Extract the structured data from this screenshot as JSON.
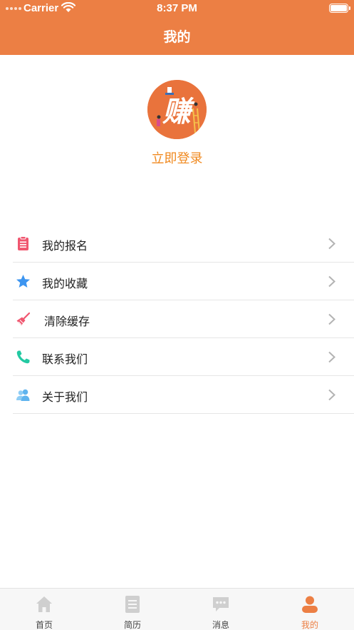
{
  "status_bar": {
    "carrier": "Carrier",
    "time": "8:37 PM"
  },
  "header": {
    "title": "我的"
  },
  "profile": {
    "avatar_text": "赚",
    "login_label": "立即登录"
  },
  "menu": [
    {
      "label": "我的报名",
      "icon": "clipboard-icon"
    },
    {
      "label": "我的收藏",
      "icon": "star-icon"
    },
    {
      "label": "清除缓存",
      "icon": "broom-icon"
    },
    {
      "label": "联系我们",
      "icon": "phone-icon"
    },
    {
      "label": "关于我们",
      "icon": "users-icon"
    }
  ],
  "tabs": [
    {
      "label": "首页",
      "icon": "home-icon",
      "active": false
    },
    {
      "label": "简历",
      "icon": "resume-icon",
      "active": false
    },
    {
      "label": "消息",
      "icon": "message-icon",
      "active": false
    },
    {
      "label": "我的",
      "icon": "profile-icon",
      "active": true
    }
  ],
  "colors": {
    "brand": "#ec7f44",
    "login_text": "#f0891f",
    "inactive_icon": "#cfcfcf"
  }
}
